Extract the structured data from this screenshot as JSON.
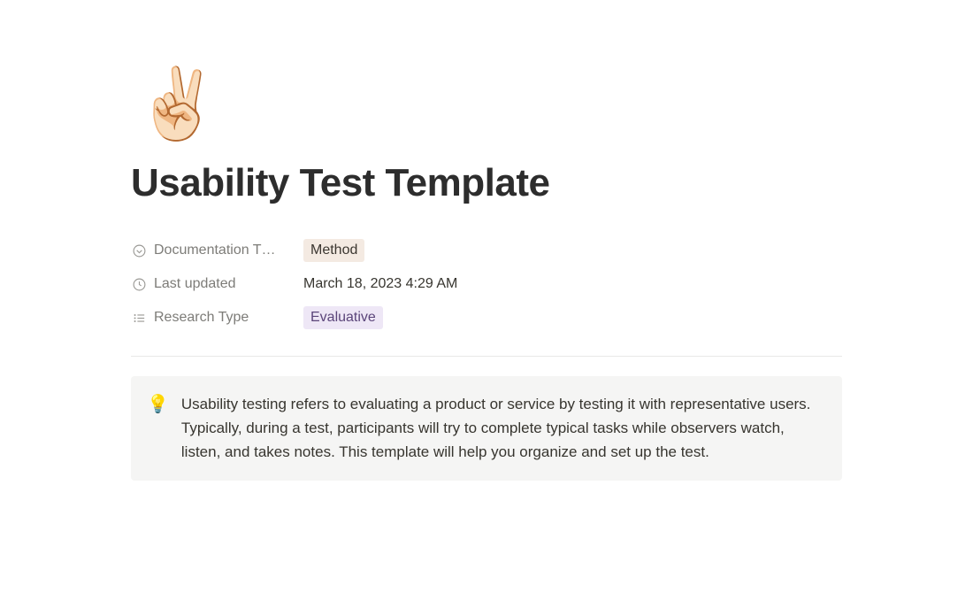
{
  "page": {
    "icon": "✌🏻",
    "title": "Usability Test Template"
  },
  "properties": [
    {
      "icon": "select-down",
      "label": "Documentation T…",
      "value": {
        "type": "tag",
        "text": "Method",
        "style": "method"
      }
    },
    {
      "icon": "clock",
      "label": "Last updated",
      "value": {
        "type": "text",
        "text": "March 18, 2023 4:29 AM"
      }
    },
    {
      "icon": "list",
      "label": "Research Type",
      "value": {
        "type": "tag",
        "text": "Evaluative",
        "style": "evaluative"
      }
    }
  ],
  "callout": {
    "icon": "💡",
    "text": "Usability testing refers to evaluating a product or service by testing it with representative users. Typically, during a test, participants will try to complete typical tasks while observers watch, listen, and takes notes. This template will help you organize and set up the test."
  }
}
